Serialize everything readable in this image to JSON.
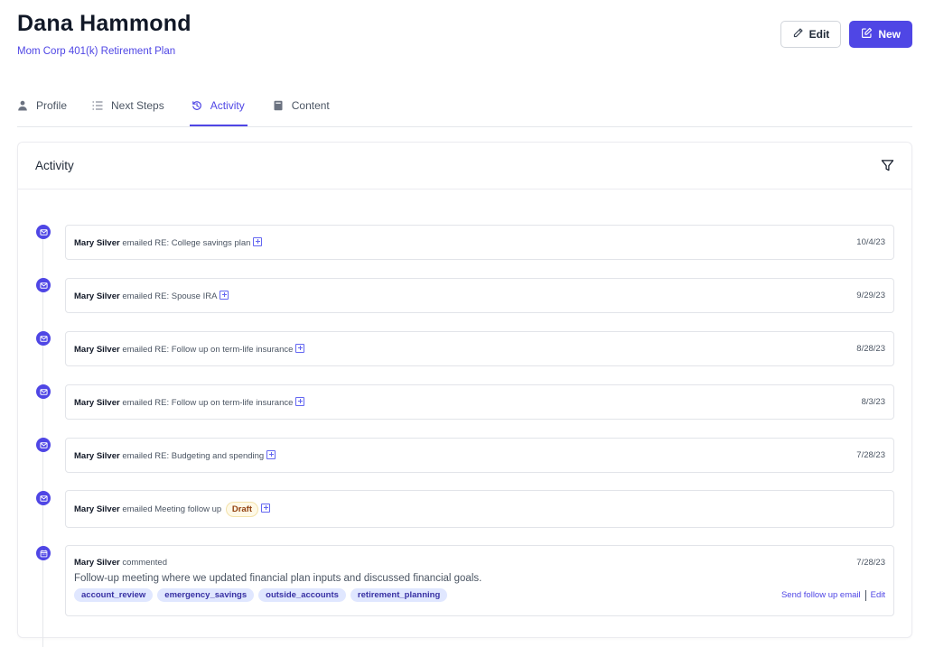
{
  "header": {
    "title": "Dana Hammond",
    "subtitle": "Mom Corp 401(k) Retirement Plan",
    "edit_label": "Edit",
    "new_label": "New"
  },
  "tabs": [
    {
      "label": "Profile",
      "icon": "person-icon"
    },
    {
      "label": "Next Steps",
      "icon": "list-icon"
    },
    {
      "label": "Activity",
      "icon": "history-icon",
      "active": true
    },
    {
      "label": "Content",
      "icon": "book-icon"
    }
  ],
  "activity": {
    "title": "Activity",
    "items": [
      {
        "who": "Mary Silver",
        "action": "emailed",
        "subject": "RE: College savings plan",
        "date": "10/4/23"
      },
      {
        "who": "Mary Silver",
        "action": "emailed",
        "subject": "RE: Spouse IRA",
        "date": "9/29/23"
      },
      {
        "who": "Mary Silver",
        "action": "emailed",
        "subject": "RE: Follow up on term-life insurance",
        "date": "8/28/23"
      },
      {
        "who": "Mary Silver",
        "action": "emailed",
        "subject": "RE: Follow up on term-life insurance",
        "date": "8/3/23"
      },
      {
        "who": "Mary Silver",
        "action": "emailed",
        "subject": "RE: Budgeting and spending",
        "date": "7/28/23"
      },
      {
        "who": "Mary Silver",
        "action": "emailed",
        "subject": "Meeting follow up",
        "badge": "Draft"
      }
    ],
    "comment": {
      "who": "Mary Silver",
      "action": "commented",
      "date": "7/28/23",
      "body": "Follow-up meeting where we updated financial plan inputs and discussed financial goals.",
      "tags": [
        "account_review",
        "emergency_savings",
        "outside_accounts",
        "retirement_planning"
      ],
      "link_send": "Send follow up email",
      "link_edit": "Edit"
    }
  },
  "colors": {
    "accent": "#4f46e5",
    "tag_bg": "#e0e7ff",
    "draft_bg": "#fef9e7"
  }
}
